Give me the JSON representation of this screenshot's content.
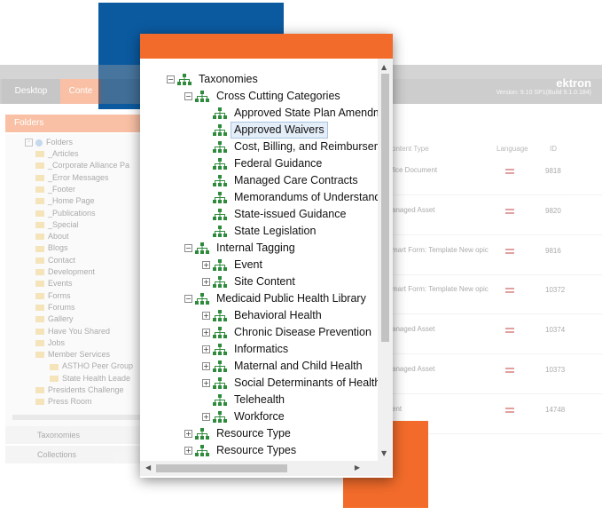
{
  "background_app": {
    "tabs": [
      "Desktop",
      "Conte"
    ],
    "logo": "ektron",
    "version": "Version: 9.10 SP1(Build 9.1.0.184)",
    "folders_header": "Folders",
    "folder_root": "Folders",
    "folders": [
      "_Articles",
      "_Corporate Alliance Pa",
      "_Error Messages",
      "_Footer",
      "_Home Page",
      "_Publications",
      "_Special",
      "About",
      "Blogs",
      "Contact",
      "Development",
      "Events",
      "Forms",
      "Forums",
      "Gallery",
      "Have You Shared",
      "Jobs",
      "Member Services",
      "ASTHO Peer Group",
      "State Health Leade",
      "Presidents Challenge",
      "Press Room"
    ],
    "accordion": [
      "Taxonomies",
      "Collections"
    ],
    "grid_headers": [
      "ontent Type",
      "Language",
      "ID"
    ],
    "rows": [
      {
        "type": "fice Document",
        "id": "9818"
      },
      {
        "type": "anaged Asset",
        "id": "9820"
      },
      {
        "type": "mart Form: Template New opic",
        "id": "9816"
      },
      {
        "type": "mart Form: Template New opic",
        "id": "10372"
      },
      {
        "type": "anaged Asset",
        "id": "10374"
      },
      {
        "type": "anaged Asset",
        "id": "10373"
      },
      {
        "type": "ent",
        "id": "14748"
      }
    ]
  },
  "taxonomy_tree": {
    "root": "Taxonomies",
    "nodes": [
      {
        "label": "Cross Cutting Categories",
        "level": 1,
        "toggle": "−"
      },
      {
        "label": "Approved State Plan Amendments",
        "level": 2,
        "toggle": ""
      },
      {
        "label": "Approved Waivers",
        "level": 2,
        "toggle": "",
        "selected": true
      },
      {
        "label": "Cost, Billing, and Reimbursement",
        "level": 2,
        "toggle": ""
      },
      {
        "label": "Federal Guidance",
        "level": 2,
        "toggle": ""
      },
      {
        "label": "Managed Care Contracts",
        "level": 2,
        "toggle": ""
      },
      {
        "label": "Memorandums of Understanding",
        "level": 2,
        "toggle": ""
      },
      {
        "label": "State-issued Guidance",
        "level": 2,
        "toggle": ""
      },
      {
        "label": "State Legislation",
        "level": 2,
        "toggle": ""
      },
      {
        "label": "Internal Tagging",
        "level": 1,
        "toggle": "−"
      },
      {
        "label": "Event",
        "level": 2,
        "toggle": "+"
      },
      {
        "label": "Site Content",
        "level": 2,
        "toggle": "+"
      },
      {
        "label": "Medicaid Public Health Library",
        "level": 1,
        "toggle": "−"
      },
      {
        "label": "Behavioral Health",
        "level": 2,
        "toggle": "+"
      },
      {
        "label": "Chronic Disease Prevention",
        "level": 2,
        "toggle": "+"
      },
      {
        "label": "Informatics",
        "level": 2,
        "toggle": "+"
      },
      {
        "label": "Maternal and Child Health",
        "level": 2,
        "toggle": "+"
      },
      {
        "label": "Social Determinants of Health",
        "level": 2,
        "toggle": "+"
      },
      {
        "label": "Telehealth",
        "level": 2,
        "toggle": ""
      },
      {
        "label": "Workforce",
        "level": 2,
        "toggle": "+"
      },
      {
        "label": "Resource Type",
        "level": 1,
        "toggle": "+"
      },
      {
        "label": "Resource Types",
        "level": 1,
        "toggle": "+"
      }
    ]
  },
  "colors": {
    "accent_orange": "#f26b2a",
    "accent_blue": "#0b5aa0",
    "icon_green": "#2e8b3c",
    "selection_bg": "#e4eef8"
  },
  "icons": {
    "taxonomy_node": "org-chart-icon",
    "folder": "folder-icon",
    "scroll_up": "▲",
    "scroll_down": "▼",
    "scroll_left": "◀",
    "scroll_right": "▶"
  }
}
